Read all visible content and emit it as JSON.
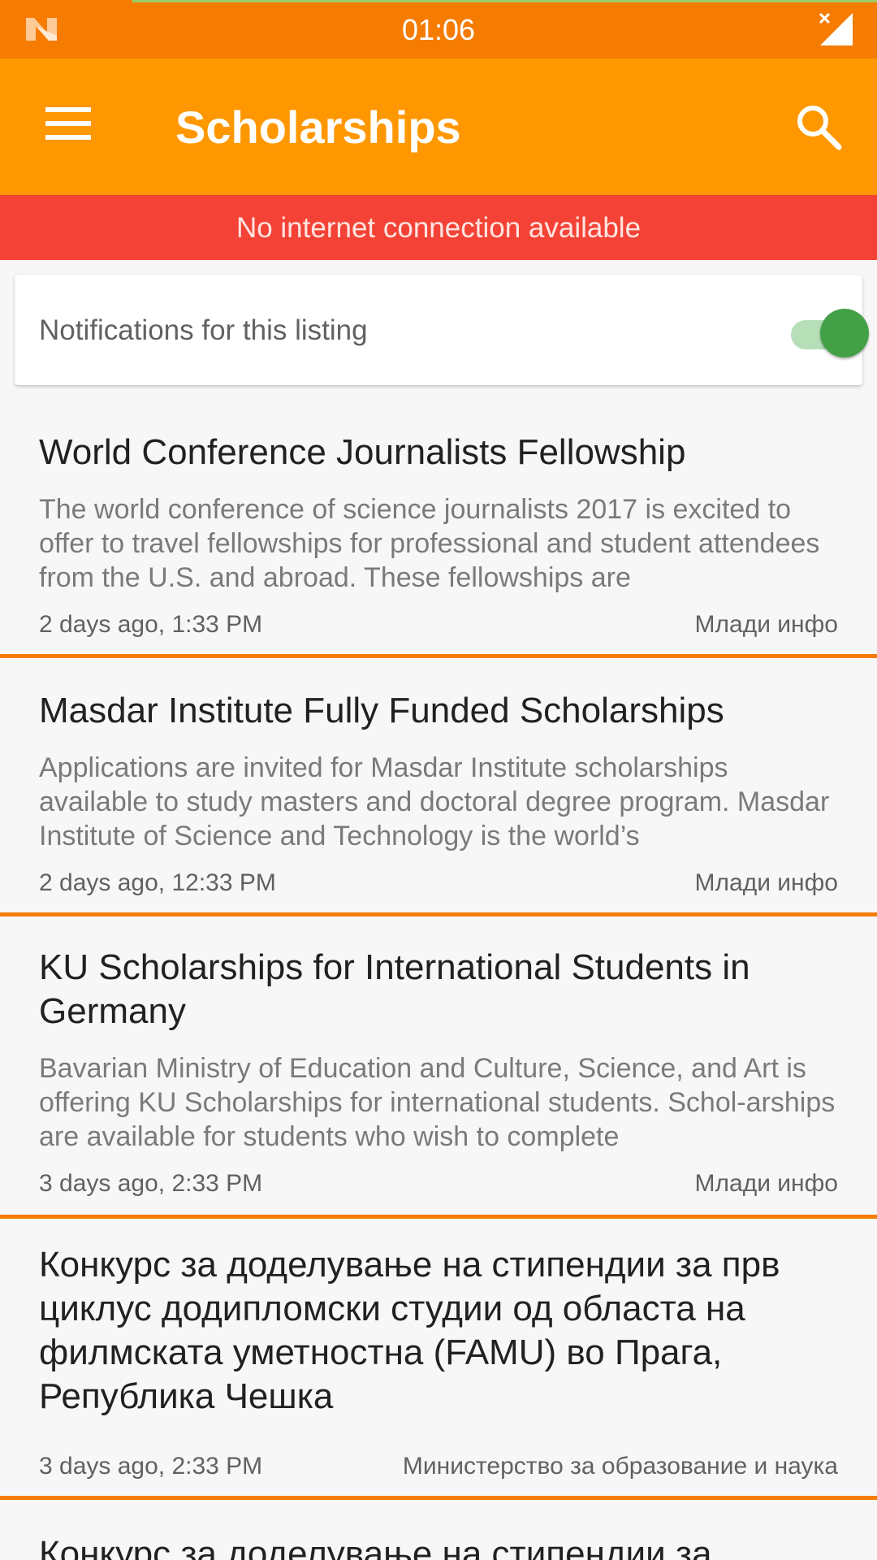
{
  "status_bar": {
    "time": "01:06",
    "notification_icon": "n-logo-icon",
    "signal_icon": "signal-no-connection-icon"
  },
  "app_bar": {
    "title": "Scholarships",
    "menu_icon": "hamburger-menu-icon",
    "search_icon": "search-icon",
    "color": "#ff9800"
  },
  "banner": {
    "text": "No internet connection available",
    "color": "#f44336"
  },
  "notifications": {
    "label": "Notifications for this listing",
    "enabled": true,
    "accent": "#43a047"
  },
  "articles": [
    {
      "title": "World Conference Journalists Fellowship",
      "excerpt": "The world conference of science journalists 2017 is excited to offer to travel fellowships for professional and student attendees from the U.S. and abroad. These fellowships are",
      "date": "2 days ago, 1:33 PM",
      "source": "Млади инфо"
    },
    {
      "title": "Masdar Institute Fully Funded Scholarships",
      "excerpt": "Applications are invited for Masdar Institute scholarships available to study masters and doctoral degree program. Masdar Institute of Science and Technology is the world’s",
      "date": "2 days ago, 12:33 PM",
      "source": "Млади инфо"
    },
    {
      "title": "KU Scholarships for International Students in Germany",
      "excerpt": "Bavarian Ministry of Education and Culture, Science, and Art is offering KU Scholarships for international students. Schol-arships are available for students who wish to complete",
      "date": "3 days ago, 2:33 PM",
      "source": "Млади инфо"
    },
    {
      "title": "Конкурс за доделување на стипендии за прв циклус додипломски студии од областа на филмската уметностна (FAMU) во Прага, Република Чешка",
      "excerpt": "",
      "date": "3 days ago, 2:33 PM",
      "source": "Министерство за образование и наука"
    },
    {
      "title": "Конкурс за доделување на стипендии за",
      "excerpt": "",
      "date": "",
      "source": ""
    }
  ],
  "divider_color": "#f57c00"
}
